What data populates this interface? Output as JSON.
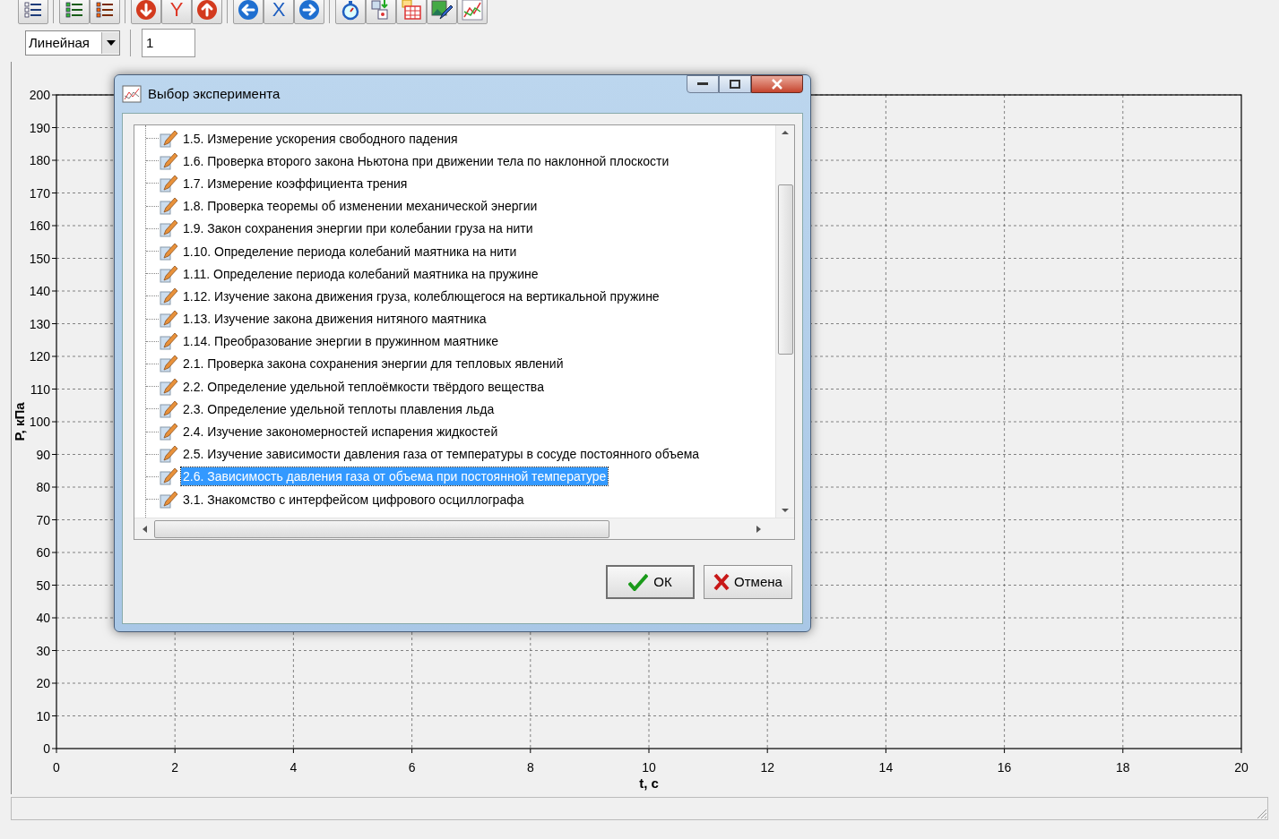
{
  "toolbar": {
    "letter_buttons": [
      "Y",
      "X"
    ],
    "scale_combo": {
      "value": "Линейная"
    },
    "count_field": {
      "value": "1"
    }
  },
  "chart": {
    "chart_data": {
      "type": "line",
      "grid": true,
      "xlabel": "t, c",
      "ylabel": "P, кПа",
      "xlim": [
        0,
        20
      ],
      "ylim": [
        0,
        200
      ],
      "xticks": [
        0,
        2,
        4,
        6,
        8,
        10,
        12,
        14,
        16,
        18,
        20
      ],
      "yticks": [
        0,
        10,
        20,
        30,
        40,
        50,
        60,
        70,
        80,
        90,
        100,
        110,
        120,
        130,
        140,
        150,
        160,
        170,
        180,
        190,
        200
      ]
    }
  },
  "dialog": {
    "title": "Выбор эксперимента",
    "items": [
      {
        "label": "1.5. Измерение ускорения свободного падения",
        "selected": false
      },
      {
        "label": "1.6. Проверка второго закона Ньютона при движении тела по наклонной плоскости",
        "selected": false
      },
      {
        "label": "1.7. Измерение коэффициента трения",
        "selected": false
      },
      {
        "label": "1.8. Проверка теоремы об изменении механической энергии",
        "selected": false
      },
      {
        "label": "1.9. Закон сохранения энергии при колебании груза на нити",
        "selected": false
      },
      {
        "label": "1.10. Определение периода колебаний маятника на нити",
        "selected": false
      },
      {
        "label": "1.11. Определение периода колебаний маятника на пружине",
        "selected": false
      },
      {
        "label": "1.12. Изучение закона движения груза, колеблющегося на вертикальной пружине",
        "selected": false
      },
      {
        "label": "1.13. Изучение закона движения нитяного маятника",
        "selected": false
      },
      {
        "label": "1.14. Преобразование энергии в пружинном маятнике",
        "selected": false
      },
      {
        "label": "2.1. Проверка закона сохранения энергии для тепловых явлений",
        "selected": false
      },
      {
        "label": "2.2. Определение удельной теплоёмкости твёрдого вещества",
        "selected": false
      },
      {
        "label": "2.3. Определение удельной теплоты плавления льда",
        "selected": false
      },
      {
        "label": "2.4. Изучение закономерностей испарения жидкостей",
        "selected": false
      },
      {
        "label": "2.5. Изучение зависимости давления газа от температуры в сосуде постоянного объема",
        "selected": false
      },
      {
        "label": "2.6. Зависимость давления газа от объема при постоянной температуре",
        "selected": true
      },
      {
        "label": "3.1. Знакомство с интерфейсом цифрового осциллографа",
        "selected": false
      }
    ],
    "ok_button": "ОК",
    "cancel_button": "Отмена"
  }
}
